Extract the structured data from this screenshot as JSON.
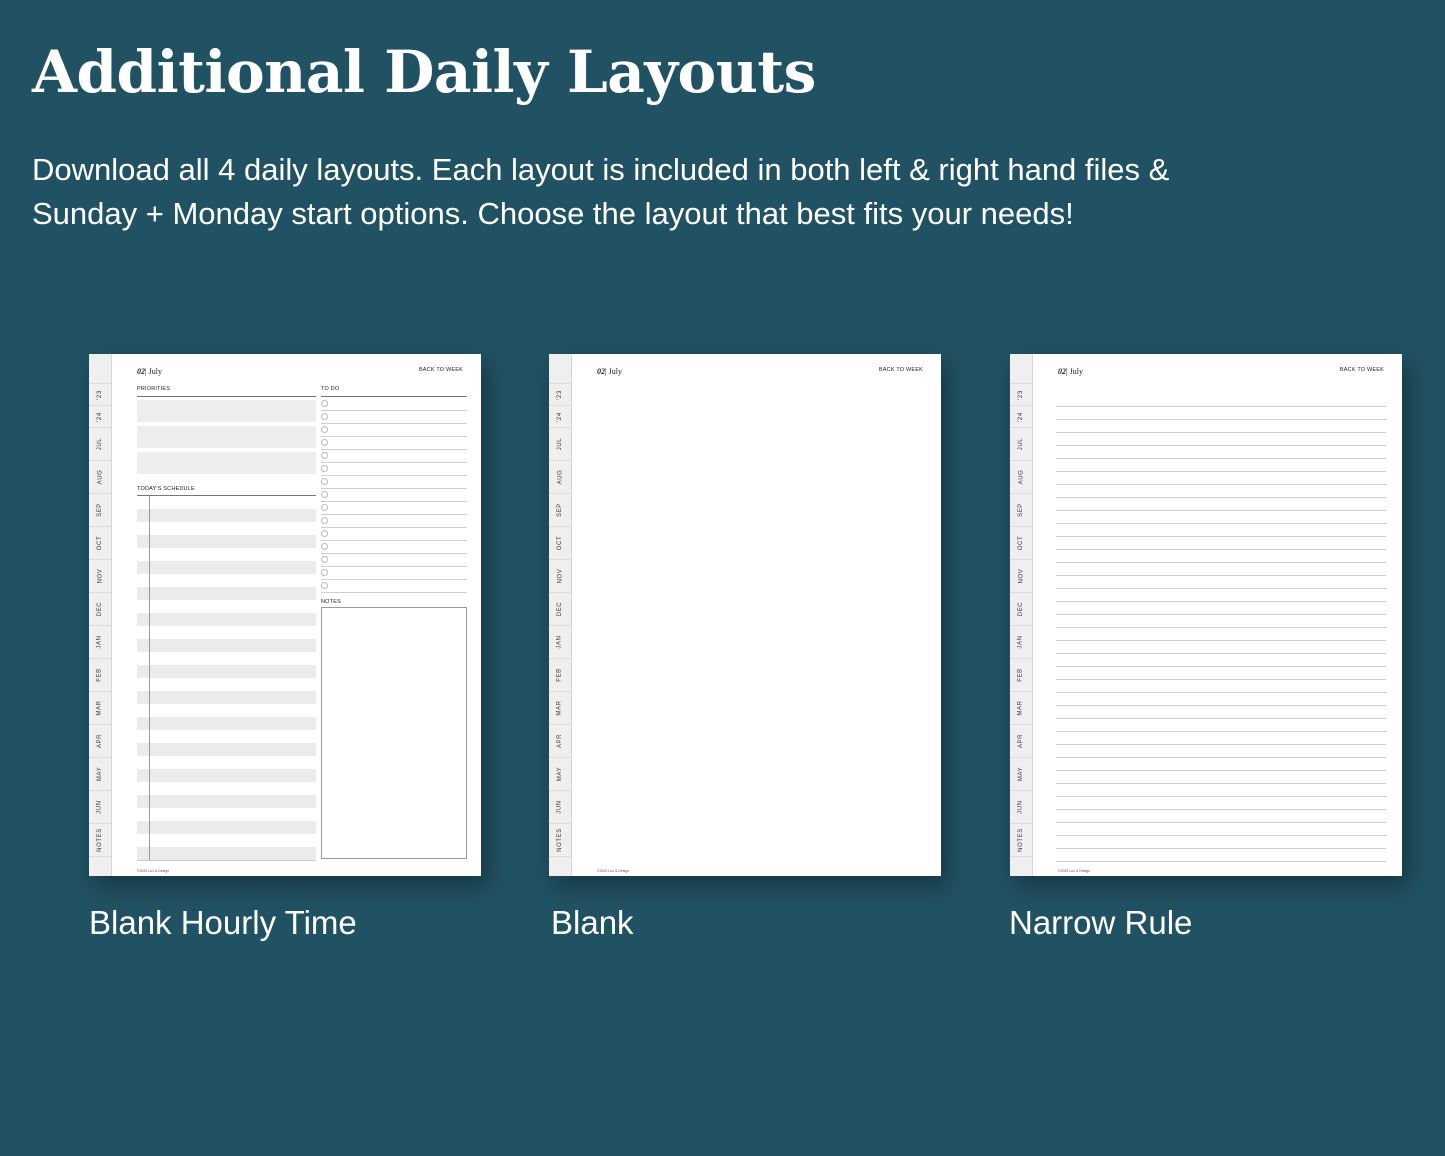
{
  "header": {
    "title": "Additional Daily Layouts",
    "subtitle_line1": "Download all  4 daily layouts. Each layout is included in both left & right hand files &",
    "subtitle_line2": "Sunday + Monday start options. Choose the layout that best fits your needs!"
  },
  "planner_page": {
    "date_number": "02",
    "date_month": "| July",
    "back_link": "BACK TO WEEK",
    "footer": "©2023 Lux & Design",
    "tabs": [
      "'23",
      "'24",
      "JUL",
      "AUG",
      "SEP",
      "OCT",
      "NOV",
      "DEC",
      "JAN",
      "FEB",
      "MAR",
      "APR",
      "MAY",
      "JUN",
      "NOTES"
    ],
    "priorities_label": "PRIORITIES",
    "todo_label": "TO DO",
    "schedule_label": "TODAY'S SCHEDULE",
    "notes_label": "NOTES"
  },
  "layouts": [
    {
      "caption": "Blank Hourly Time"
    },
    {
      "caption": "Blank"
    },
    {
      "caption": "Narrow Rule"
    }
  ],
  "colors": {
    "background": "#215263",
    "page": "#ffffff",
    "text": "#ffffff"
  }
}
